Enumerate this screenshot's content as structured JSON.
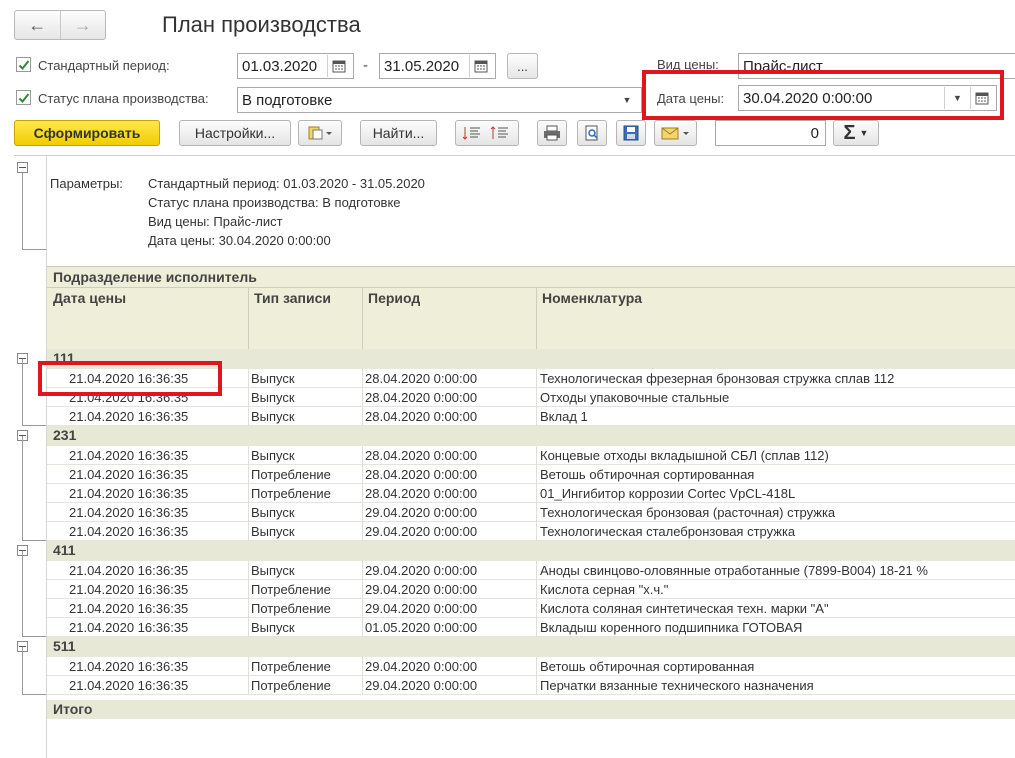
{
  "window": {
    "title": "План производства",
    "back": "←",
    "forward": "→"
  },
  "form": {
    "standard_period": {
      "label": "Стандартный период:",
      "from": "01.03.2020",
      "dash": "-",
      "to": "31.05.2020",
      "more": "..."
    },
    "status": {
      "label": "Статус плана производства:",
      "value": "В подготовке"
    },
    "price_type": {
      "label": "Вид цены:",
      "value": "Прайс-лист"
    },
    "price_date": {
      "label": "Дата цены:",
      "value": "30.04.2020  0:00:00"
    }
  },
  "toolbar": {
    "generate": "Сформировать",
    "settings": "Настройки...",
    "find": "Найти...",
    "number": "0",
    "sum": "Σ"
  },
  "report": {
    "params_label": "Параметры:",
    "params": [
      "Стандартный период: 01.03.2020 - 31.05.2020",
      "Статус плана производства: В подготовке",
      "Вид цены: Прайс-лист",
      "Дата цены: 30.04.2020 0:00:00"
    ],
    "group_header": "Подразделение исполнитель",
    "columns": [
      "Дата цены",
      "Тип записи",
      "Период",
      "Номенклатура"
    ],
    "groups": [
      {
        "name": "111",
        "rows": [
          [
            "21.04.2020 16:36:35",
            "Выпуск",
            "28.04.2020 0:00:00",
            "Технологическая фрезерная бронзовая стружка сплав 112"
          ],
          [
            "21.04.2020 16:36:35",
            "Выпуск",
            "28.04.2020 0:00:00",
            "Отходы упаковочные стальные"
          ],
          [
            "21.04.2020 16:36:35",
            "Выпуск",
            "28.04.2020 0:00:00",
            "Вклад 1"
          ]
        ]
      },
      {
        "name": "231",
        "rows": [
          [
            "21.04.2020 16:36:35",
            "Выпуск",
            "28.04.2020 0:00:00",
            "Концевые отходы вкладышной СБЛ (сплав 112)"
          ],
          [
            "21.04.2020 16:36:35",
            "Потребление",
            "28.04.2020 0:00:00",
            "Ветошь обтирочная сортированная"
          ],
          [
            "21.04.2020 16:36:35",
            "Потребление",
            "28.04.2020 0:00:00",
            "01_Ингибитор коррозии Cortec VpCL-418L"
          ],
          [
            "21.04.2020 16:36:35",
            "Выпуск",
            "29.04.2020 0:00:00",
            "Технологическая бронзовая (расточная) стружка"
          ],
          [
            "21.04.2020 16:36:35",
            "Выпуск",
            "29.04.2020 0:00:00",
            "Технологическая сталебронзовая стружка"
          ]
        ]
      },
      {
        "name": "411",
        "rows": [
          [
            "21.04.2020 16:36:35",
            "Выпуск",
            "29.04.2020 0:00:00",
            "Аноды свинцово-оловянные отработанные (7899-В004) 18-21 %"
          ],
          [
            "21.04.2020 16:36:35",
            "Потребление",
            "29.04.2020 0:00:00",
            "Кислота серная \"х.ч.\""
          ],
          [
            "21.04.2020 16:36:35",
            "Потребление",
            "29.04.2020 0:00:00",
            "Кислота соляная синтетическая техн. марки \"А\""
          ],
          [
            "21.04.2020 16:36:35",
            "Выпуск",
            "01.05.2020 0:00:00",
            "Вкладыш коренного подшипника ГОТОВАЯ"
          ]
        ]
      },
      {
        "name": "511",
        "rows": [
          [
            "21.04.2020 16:36:35",
            "Потребление",
            "29.04.2020 0:00:00",
            "Ветошь обтирочная сортированная"
          ],
          [
            "21.04.2020 16:36:35",
            "Потребление",
            "29.04.2020 0:00:00",
            "Перчатки вязанные технического назначения"
          ]
        ]
      }
    ],
    "total_label": "Итого"
  },
  "colors": {
    "highlight": "#e0161e",
    "generate_button": "#f2cc00",
    "group_bar": "#e8e8d6"
  }
}
